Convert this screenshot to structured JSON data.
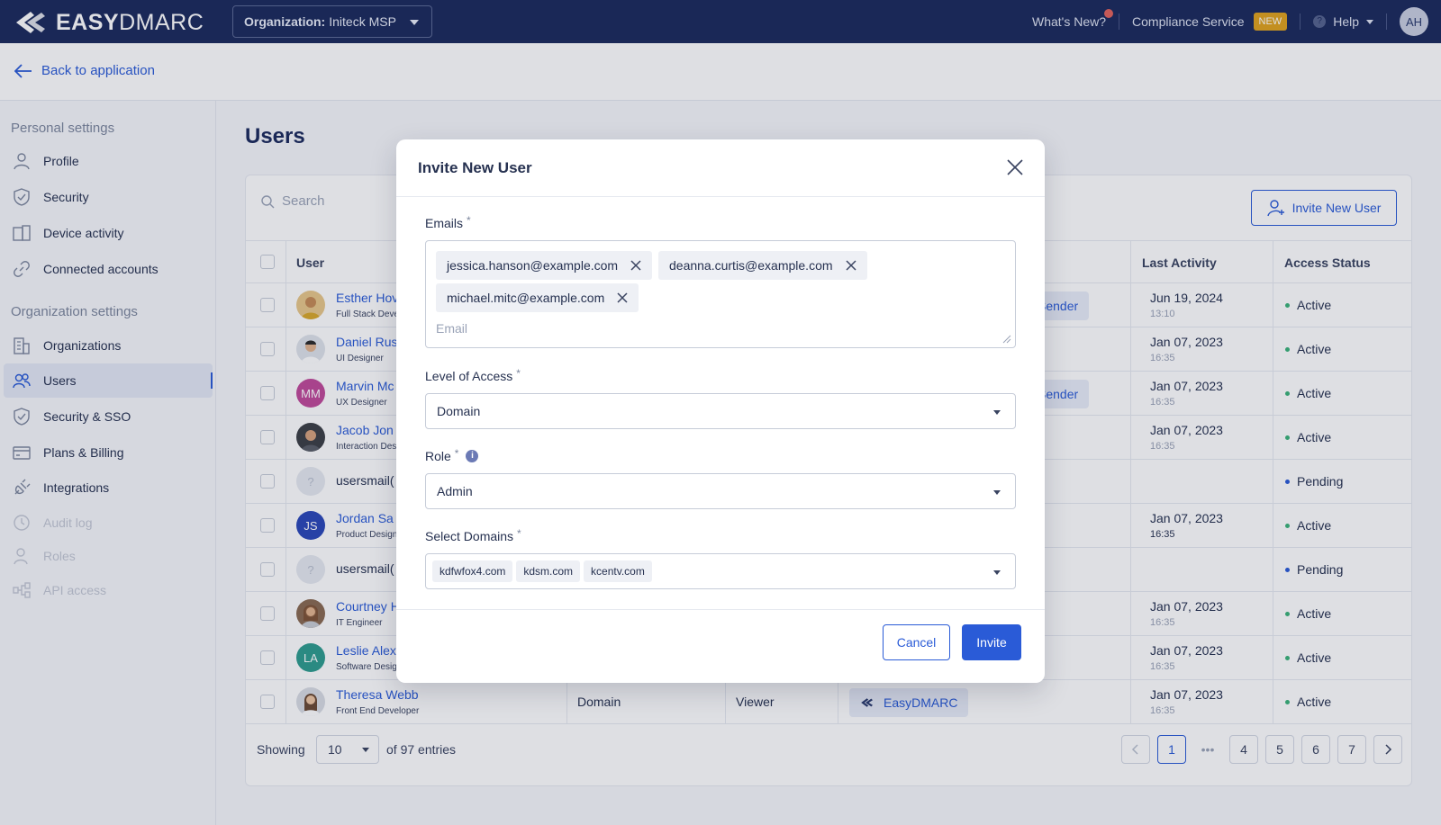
{
  "brand": {
    "name_bold": "EASY",
    "name_rest": "DMARC"
  },
  "topbar": {
    "org_label": "Organization:",
    "org_value": "Initeck MSP",
    "whats_new": "What's New?",
    "compliance": "Compliance Service",
    "new_badge": "NEW",
    "help": "Help",
    "avatar_initials": "AH"
  },
  "backbar": {
    "back_label": "Back to application"
  },
  "sidebar": {
    "personal_title": "Personal settings",
    "org_title": "Organization settings",
    "personal": [
      {
        "label": "Profile",
        "icon": "user-icon"
      },
      {
        "label": "Security",
        "icon": "shield-check-icon"
      },
      {
        "label": "Device activity",
        "icon": "devices-icon"
      },
      {
        "label": "Connected accounts",
        "icon": "link-icon"
      }
    ],
    "org": [
      {
        "label": "Organizations",
        "icon": "building-icon"
      },
      {
        "label": "Users",
        "icon": "users-icon",
        "active": true
      },
      {
        "label": "Security & SSO",
        "icon": "shield-icon"
      },
      {
        "label": "Plans & Billing",
        "icon": "card-icon"
      },
      {
        "label": "Integrations",
        "icon": "plug-icon"
      },
      {
        "label": "Audit log",
        "icon": "clock-icon",
        "disabled": true
      },
      {
        "label": "Roles",
        "icon": "user-role-icon",
        "disabled": true
      },
      {
        "label": "API access",
        "icon": "api-icon",
        "disabled": true
      }
    ]
  },
  "main": {
    "title": "Users",
    "search_placeholder": "Search",
    "invite_button": "Invite New User",
    "columns": {
      "user": "User",
      "last_activity": "Last Activity",
      "access_status": "Access Status"
    },
    "rows": [
      {
        "name": "Esther Hov",
        "title": "Full Stack Deve",
        "partner": "ySender",
        "act_date": "Jun 19, 2024",
        "act_time": "13:10",
        "status": "Active"
      },
      {
        "name": "Daniel Rus",
        "title": "UI Designer",
        "act_date": "Jan 07, 2023",
        "act_time": "16:35",
        "status": "Active"
      },
      {
        "name": "Marvin Mc",
        "title": "UX Designer",
        "initials": "MM",
        "partner": "ySender",
        "act_date": "Jan 07, 2023",
        "act_time": "16:35",
        "status": "Active"
      },
      {
        "name": "Jacob Jon",
        "title": "Interaction Des",
        "act_date": "Jan 07, 2023",
        "act_time": "16:35",
        "status": "Active"
      },
      {
        "email": "usersmail(",
        "avatar_glyph": "?",
        "status": "Pending"
      },
      {
        "name": "Jordan Sa",
        "title": "Product Design",
        "initials": "JS",
        "act_date": "Jan 07, 2023",
        "act_time": "16:35",
        "status": "Active"
      },
      {
        "email": "usersmail(",
        "avatar_glyph": "?",
        "status": "Pending"
      },
      {
        "name": "Courtney H",
        "title": "IT Engineer",
        "act_date": "Jan 07, 2023",
        "act_time": "16:35",
        "status": "Active"
      },
      {
        "name": "Leslie Alex",
        "title": "Software Desig",
        "initials": "LA",
        "act_date": "Jan 07, 2023",
        "act_time": "16:35",
        "status": "Active"
      },
      {
        "name": "Theresa Webb",
        "title": "Front End Developer",
        "access": "Domain",
        "role": "Viewer",
        "domain": "EasyDMARC",
        "act_date": "Jan 07, 2023",
        "act_time": "16:35",
        "status": "Active"
      }
    ],
    "footer": {
      "showing": "Showing",
      "per_page": "10",
      "entries": "of 97 entries",
      "pages": [
        "1",
        "4",
        "5",
        "6",
        "7"
      ],
      "ellipsis": "•••",
      "current_page": "1"
    }
  },
  "modal": {
    "title": "Invite New User",
    "emails_label": "Emails",
    "required_mark": "*",
    "email_tags": [
      "jessica.hanson@example.com",
      "deanna.curtis@example.com",
      "michael.mitc@example.com"
    ],
    "email_placeholder": "Email",
    "access_label": "Level of Access",
    "access_value": "Domain",
    "role_label": "Role",
    "role_info": "i",
    "role_value": "Admin",
    "domains_label": "Select Domains",
    "domains": [
      "kdfwfox4.com",
      "kdsm.com",
      "kcentv.com"
    ],
    "cancel": "Cancel",
    "invite": "Invite"
  },
  "colors": {
    "topbar_bg": "#1b2a5c",
    "accent": "#2a5bd7",
    "active_dot": "#3bb37a",
    "pending_dot": "#2a5bd7",
    "new_badge": "#e0a21e"
  }
}
